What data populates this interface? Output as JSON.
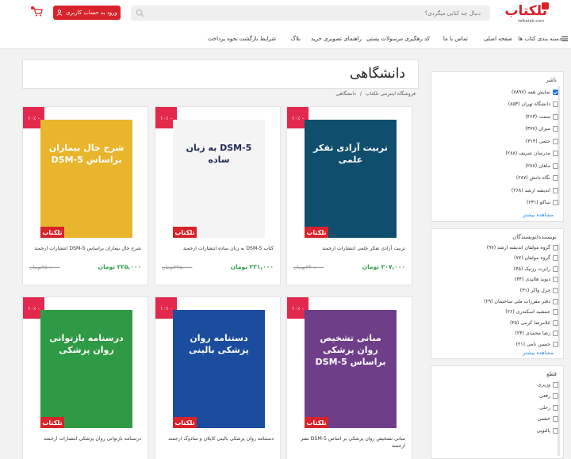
{
  "header": {
    "logo_text": "تلکتاب",
    "logo_sub": "telkatab.com",
    "search_placeholder": "دنبال چه کتابی میگردی؟",
    "login_label": "ورود به حساب کاربری"
  },
  "nav": {
    "items": [
      "دسته بندی کتاب ها",
      "صفحه اصلی",
      "تماس با ما",
      "کد رهگیری مرسولات پستی",
      "راهنمای تصویری خرید",
      "بلاگ",
      "شرایط بازگشت",
      "نحوه پرداخت"
    ]
  },
  "sidebar": {
    "publisher": {
      "title": "ناشر",
      "items": [
        {
          "label": "نمایش همه (۷۸۹۷)",
          "checked": true
        },
        {
          "label": "دانشگاه تهران (۸۵۳)",
          "checked": false
        },
        {
          "label": "سمت (۴۶۳)",
          "checked": false
        },
        {
          "label": "میزان (۳۷۷)",
          "checked": false
        },
        {
          "label": "حتمی (۳۱۳)",
          "checked": false
        },
        {
          "label": "مدرسان شریف (۲۸۸)",
          "checked": false
        },
        {
          "label": "ماهان (۲۸۷)",
          "checked": false
        },
        {
          "label": "نگاه دانش (۲۸۷)",
          "checked": false
        },
        {
          "label": "اندیشه ارشد (۲۶۸)",
          "checked": false
        },
        {
          "label": "ساکو (۲۳۱)",
          "checked": false
        }
      ],
      "more": "مشاهده بیشتر"
    },
    "author": {
      "title": "نویسنده/نویسندگان",
      "items": [
        {
          "label": "گروه مولفان اندیشه ارشد (۹۷)"
        },
        {
          "label": "گروه مولفان (۷۷)"
        },
        {
          "label": "رابرت رزنیک (۴۵)"
        },
        {
          "label": "دیوید هالیدی (۴۴)"
        },
        {
          "label": "جرل واکر (۳۱)"
        },
        {
          "label": "دفتر مقررات ملی ساختمان (۲۹)"
        },
        {
          "label": "جمشید اسکندری (۲۶)"
        },
        {
          "label": "غلامرضا کرمی (۲۵)"
        },
        {
          "label": "رضا محمدی (۲۴)"
        },
        {
          "label": "حسین نامی (۲۱)"
        }
      ],
      "more": "مشاهده بیشتر"
    },
    "size": {
      "title": "قطع",
      "items": [
        {
          "label": "وزیری"
        },
        {
          "label": "رقعی"
        },
        {
          "label": "رحلی"
        },
        {
          "label": "خشتی"
        },
        {
          "label": "پالتویی"
        }
      ]
    }
  },
  "main": {
    "title": "دانشگاهی",
    "breadcrumb": [
      "فروشگاه اینترنتی تلکتاب",
      "/",
      "دانشگاهی"
    ]
  },
  "products": [
    {
      "discount": "۱۰٪ -",
      "cover_title": "تربیت آزادی تفکر علمی",
      "name": "تربیت آزادی تفکر علمی انتشارات ارجمند",
      "old_price": "۲۳۰,۰۰۰",
      "new_price": "۲۰۷,۰۰۰ تومان",
      "color": "#0f4e6d"
    },
    {
      "discount": "۱۰٪ -",
      "cover_title": "DSM-5 به زبان ساده",
      "name": "کتاب DSM-5 به زبان ساده انتشارات ارجمند",
      "old_price": "۲۴۵,۰۰۰",
      "new_price": "۲۲۱,۰۰۰ تومان",
      "color": "#f4f4f4"
    },
    {
      "discount": "۱۰٪ -",
      "cover_title": "شرح حال بیماران براساس DSM-5",
      "name": "شرح حال بیماران براساس DSM-5 انتشارات ارجمند",
      "old_price": "۲۵۰,۰۰۰",
      "new_price": "۲۲۵,۰۰۰ تومان",
      "color": "#e8b52d"
    },
    {
      "discount": "۱۰٪ -",
      "cover_title": "مبانی تشخیص روان پزشکی براساس DSM-5",
      "name": "مبانی تشخیص روان پزشکی بر اساس DSM-5 نشر ارجمند",
      "old_price": "",
      "new_price": "",
      "color": "#6e3f88"
    },
    {
      "discount": "۱۰٪ -",
      "cover_title": "دستنامه روان پزشکی بالینی",
      "name": "دستنامه روان پزشکی بالینی کاپلان و سادوک ارجمند",
      "old_price": "",
      "new_price": "",
      "color": "#1b4d9e"
    },
    {
      "discount": "۱۰٪ -",
      "cover_title": "درسنامه بازتوانی روان پزشکی",
      "name": "درسنامه بازتوانی روان پزشکی انتشارات ارجمند",
      "old_price": "",
      "new_price": "",
      "color": "#2f9a45"
    }
  ],
  "colors": {
    "accent": "#d8232a",
    "discount": "#e3284d",
    "price": "#2e9e4e",
    "link": "#1e88e5"
  }
}
